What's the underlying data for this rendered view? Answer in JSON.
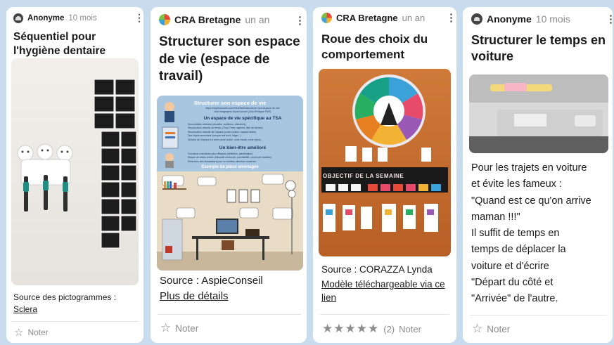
{
  "cards": [
    {
      "author": "Anonyme",
      "time": "10 mois",
      "title": "Séquentiel pour l'hygiène dentaire",
      "source_label": "Source des pictogrammes :",
      "source_link": "Sclera",
      "rate_label": "Noter"
    },
    {
      "author": "CRA Bretagne",
      "time": "un an",
      "title": "Structurer son espace de vie (espace de travail)",
      "infographic": {
        "title": "Structurer son espace de vie",
        "url": "https://aspieconseil.com/2018/08/04/structurer-son-espace-de-vie/",
        "credit": "Une infographie AspieConseil (Jean-Philippe PIAT)",
        "section1": "Un espace de vie spécifique au TSA",
        "bullets1": [
          "Sensorialités réduites (visuelles, auditives, olfactives)",
          "Structuration visuelle du temps (Time-Timer, agenda, liste de tâches)",
          "Structuration visuelle de l'espace (code couleur, espace dédié)",
          "Des objets sensoriels (casque anti bruit, fidget...)",
          "Division de l'espace en zone (zone active, zone travail, zone repos)"
        ],
        "section2": "Un bien-être amélioré",
        "bullets2": [
          "Fonctions exécutives plus efficaces (inhibition, planification)",
          "Risque de crises réduit ( efficacité renforcée, prévisibilité, recherche facilitée)",
          "Réduction des distracteurs pour un meilleur attention soutenue"
        ],
        "example": "Exemple de pièce aménagée"
      },
      "source_label": "Source : AspieConseil",
      "details_link": "Plus de détails",
      "rate_label": "Noter"
    },
    {
      "author": "CRA Bretagne",
      "time": "un an",
      "title": "Roue des choix du comportement",
      "board_text": "OBJECTIF DE LA SEMAINE",
      "source_label": "Source : CORAZZA Lynda",
      "model_link": "Modèle téléchargeable via ce lien",
      "rating_count": "(2)",
      "rating_value": 5,
      "rate_label": "Noter"
    },
    {
      "author": "Anonyme",
      "time": "10 mois",
      "title": "Structurer le temps en voiture",
      "body_lines": [
        "Pour les trajets en voiture",
        "et évite les fameux :",
        "\"Quand est ce qu'on arrive",
        "maman !!!\"",
        "Il suffit de temps en",
        "temps de déplacer la",
        "voiture et d'écrire",
        "\"Départ du côté et",
        "\"Arrivée\" de l'autre."
      ],
      "rate_label": "Noter"
    }
  ],
  "icons": {
    "more": "⋮",
    "star_empty": "☆",
    "star_full": "★"
  },
  "colors": {
    "background": "#c9dcee",
    "text": "#1a1a1a",
    "muted": "#8c8c8c",
    "accent_blue": "#3b6fb0"
  }
}
